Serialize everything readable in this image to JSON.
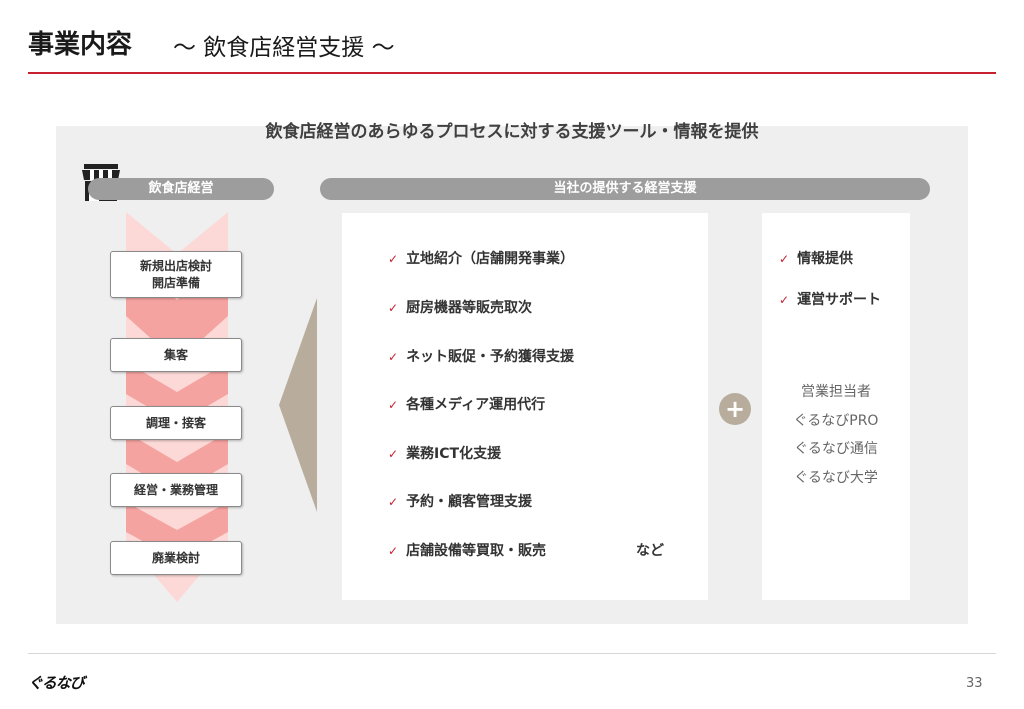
{
  "header": {
    "title": "事業内容",
    "subtitle": "～ 飲食店経営支援 ～"
  },
  "main": {
    "heading": "飲食店経営のあらゆるプロセスに対する支援ツール・情報を提供",
    "left_label": "飲食店経営",
    "right_label": "当社の提供する経営支援",
    "steps": [
      "新規出店検討\n開店準備",
      "集客",
      "調理・接客",
      "経営・業務管理",
      "廃業検討"
    ],
    "services": [
      "立地紹介（店舗開発事業）",
      "厨房機器等販売取次",
      "ネット販促・予約獲得支援",
      "各種メディア運用代行",
      "業務ICT化支援",
      "予約・顧客管理支援",
      "店舗設備等買取・販売"
    ],
    "services_suffix": "など",
    "side_items": [
      "情報提供",
      "運営サポート"
    ],
    "side_sources": [
      "営業担当者",
      "ぐるなびPRO",
      "ぐるなび通信",
      "ぐるなび大学"
    ],
    "check_icon": "✓",
    "plus_icon": "+"
  },
  "footer": {
    "logo": "ぐるなび",
    "page_number": "33"
  },
  "colors": {
    "accent_red": "#c8202f",
    "pill_gray": "#9d9d9d",
    "arrow_tan": "#b8ad9c",
    "flow_light": "#fcd9d6",
    "flow_dark": "#f5a3a0"
  }
}
